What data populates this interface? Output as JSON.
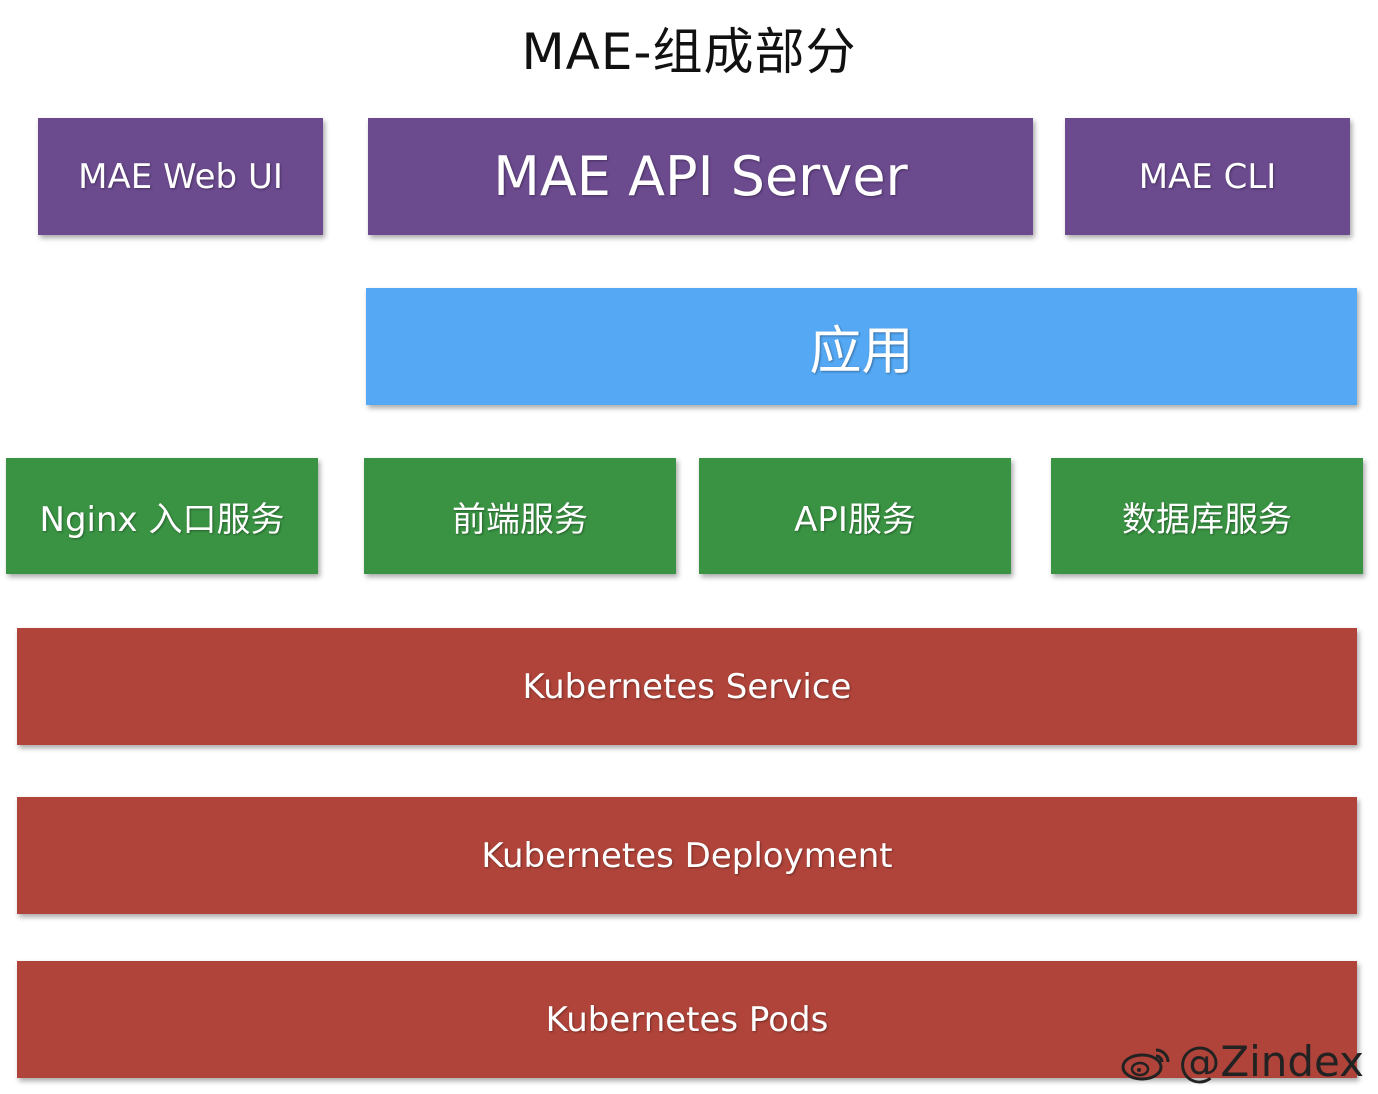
{
  "title": "MAE-组成部分",
  "top_row": {
    "web_ui": "MAE Web UI",
    "api_server": "MAE API Server",
    "cli": "MAE CLI"
  },
  "app": {
    "label": "应用"
  },
  "services": {
    "nginx": "Nginx 入口服务",
    "frontend": "前端服务",
    "api": "API服务",
    "database": "数据库服务"
  },
  "k8s": {
    "service": "Kubernetes Service",
    "deployment": "Kubernetes Deployment",
    "pods": "Kubernetes Pods"
  },
  "watermark": {
    "text": "@Zindex",
    "icon": "weibo-icon"
  },
  "colors": {
    "purple": "#6b4a8e",
    "blue": "#54a8f4",
    "green": "#3a9343",
    "red": "#b0443a"
  }
}
